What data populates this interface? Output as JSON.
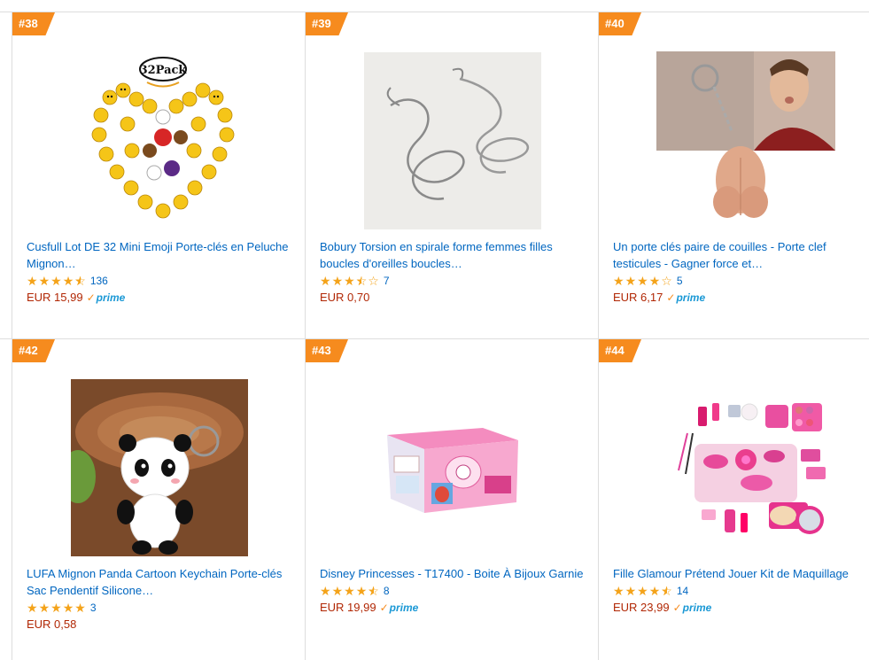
{
  "products": [
    {
      "rank": "#38",
      "title_line1": "Cusfull Lot DE 32 Mini Emoji Porte-clés en Peluche",
      "title_line2": "Mignon…",
      "rating": 4.5,
      "review_count": "136",
      "price": "EUR 15,99",
      "prime": true,
      "image": "emoji-keychains-heart",
      "image_label": "32Pack"
    },
    {
      "rank": "#39",
      "title_line1": "Bobury Torsion en spirale forme femmes filles",
      "title_line2": "boucles d'oreilles boucles…",
      "rating": 3.5,
      "review_count": "7",
      "price": "EUR 0,70",
      "prime": false,
      "image": "spiral-earrings"
    },
    {
      "rank": "#40",
      "title_line1": "Un porte clés paire de couilles - Porte clef",
      "title_line2": "testicules - Gagner force et…",
      "rating": 4.0,
      "review_count": "5",
      "price": "EUR 6,17",
      "prime": true,
      "image": "novelty-keychain-man"
    },
    {
      "rank": "#42",
      "title_line1": "LUFA Mignon Panda Cartoon Keychain Porte-clés",
      "title_line2": "Sac Pendentif Silicone…",
      "rating": 5.0,
      "review_count": "3",
      "price": "EUR 0,58",
      "prime": false,
      "image": "panda-keychain"
    },
    {
      "rank": "#43",
      "title_line1": "Disney Princesses - T17400 - Boite À Bijoux Garnie",
      "title_line2": "",
      "rating": 4.5,
      "review_count": "8",
      "price": "EUR 19,99",
      "prime": true,
      "image": "jewelry-box"
    },
    {
      "rank": "#44",
      "title_line1": "Fille Glamour Prétend Jouer Kit de Maquillage",
      "title_line2": "",
      "rating": 4.5,
      "review_count": "14",
      "price": "EUR 23,99",
      "prime": true,
      "image": "makeup-kit"
    }
  ],
  "prime_label": "prime",
  "colors": {
    "badge": "#f68b1e",
    "link": "#0066c0",
    "price": "#b12704",
    "star": "#f4a31a",
    "prime": "#1a98d5"
  }
}
